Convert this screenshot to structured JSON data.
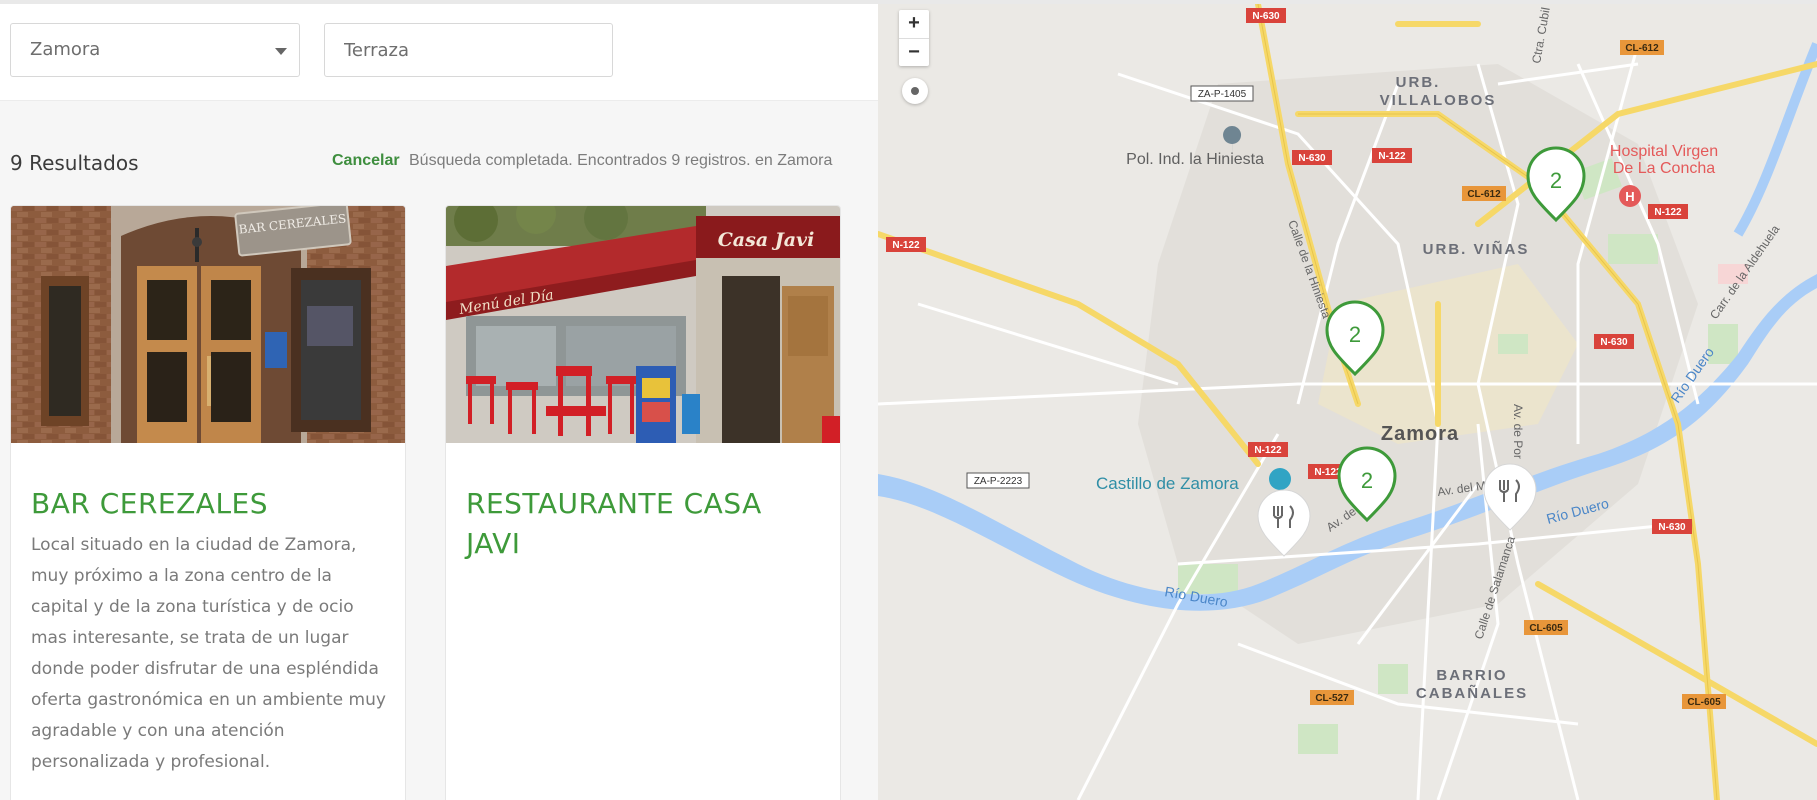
{
  "filters": {
    "city_select": "Zamora",
    "search_input": "Terraza"
  },
  "results": {
    "count_label": "9 Resultados",
    "cancel_label": "Cancelar",
    "status": "Búsqueda completada. Encontrados 9 registros. en Zamora"
  },
  "cards": [
    {
      "title": "BAR CEREZALES",
      "sign": "BAR CEREZALES",
      "description": "Local situado en la ciudad de Zamora, muy próximo a la zona centro de la capital y de la zona turística y de ocio mas interesante, se trata de un lugar donde poder disfrutar de una espléndida oferta gastronómica en un ambiente muy agradable y con una atención personalizada y profesional."
    },
    {
      "title": "RESTAURANTE CASA JAVI",
      "sign": "Casa Javi",
      "awning": "Menú del Día"
    }
  ],
  "map": {
    "zoom_in": "+",
    "zoom_out": "−",
    "city": "Zamora",
    "districts": [
      "URB.",
      "VILLALOBOS",
      "URB. VIÑAS",
      "BARRIO",
      "CABAÑALES"
    ],
    "pois": [
      "Pol. Ind. la Hiniesta",
      "Hospital Virgen",
      "De La Concha",
      "Castillo de Zamora"
    ],
    "streets": [
      "Calle de la Hiniesta",
      "Av. de Por",
      "Av. del Me",
      "Av. de",
      "Calle de Salamanca",
      "Carr. de la Aldehuela",
      "Ctra. Cubil"
    ],
    "rivers": [
      "Río Duero",
      "Río Duero",
      "Río Duero"
    ],
    "shields_red": [
      "N-630",
      "N-122",
      "N-630",
      "N-122",
      "N-122",
      "N-630",
      "N-122",
      "N-122",
      "N-630"
    ],
    "shields_orange": [
      "CL-612",
      "CL-612",
      "CL-605",
      "CL-527",
      "CL-605"
    ],
    "shields_white": [
      "ZA-P-1405",
      "ZA-P-2223"
    ],
    "cluster_counts": [
      "2",
      "2",
      "2"
    ],
    "colors": {
      "accent": "#3e9a3a",
      "highway": "#f6d868",
      "river": "#a9cdf7",
      "road_red": "#d9433b",
      "road_orange": "#e8963a"
    }
  }
}
